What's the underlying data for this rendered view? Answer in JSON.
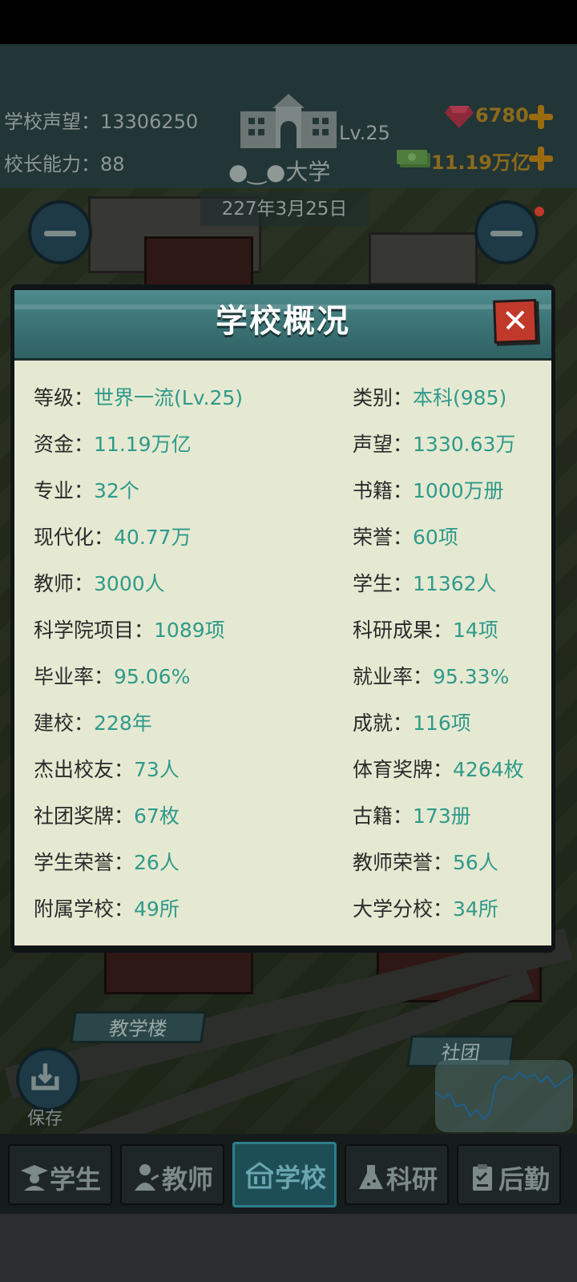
{
  "hud": {
    "reputation_label": "学校声望：",
    "reputation_value": "13306250",
    "ability_label": "校长能力：",
    "ability_value": "88",
    "level": "Lv.25",
    "school_name": "大学",
    "gems": "6780",
    "money": "11.19万亿",
    "date": "227年3月25日"
  },
  "panel": {
    "title": "学校概况",
    "rows": [
      {
        "left_key": "等级：",
        "left_val": "世界一流(Lv.25)",
        "right_key": "类别：",
        "right_val": "本科(985)"
      },
      {
        "left_key": "资金：",
        "left_val": "11.19万亿",
        "right_key": "声望：",
        "right_val": "1330.63万"
      },
      {
        "left_key": "专业：",
        "left_val": "32个",
        "right_key": "书籍：",
        "right_val": "1000万册"
      },
      {
        "left_key": "现代化：",
        "left_val": "40.77万",
        "right_key": "荣誉：",
        "right_val": "60项"
      },
      {
        "left_key": "教师：",
        "left_val": "3000人",
        "right_key": "学生：",
        "right_val": "11362人"
      },
      {
        "left_key": "科学院项目：",
        "left_val": "1089项",
        "right_key": "科研成果：",
        "right_val": "14项"
      },
      {
        "left_key": "毕业率：",
        "left_val": "95.06%",
        "right_key": "就业率：",
        "right_val": "95.33%"
      },
      {
        "left_key": "建校：",
        "left_val": "228年",
        "right_key": "成就：",
        "right_val": "116项"
      },
      {
        "left_key": "杰出校友：",
        "left_val": "73人",
        "right_key": "体育奖牌：",
        "right_val": "4264枚"
      },
      {
        "left_key": "社团奖牌：",
        "left_val": "67枚",
        "right_key": "古籍：",
        "right_val": "173册"
      },
      {
        "left_key": "学生荣誉：",
        "left_val": "26人",
        "right_key": "教师荣誉：",
        "right_val": "56人"
      },
      {
        "left_key": "附属学校：",
        "left_val": "49所",
        "right_key": "大学分校：",
        "right_val": "34所"
      }
    ]
  },
  "map": {
    "building_label": "教学楼",
    "club_label": "社团",
    "save_label": "保存"
  },
  "nav": {
    "students": "学生",
    "teachers": "教师",
    "school": "学校",
    "research": "科研",
    "logistics": "后勤"
  },
  "icons": [
    "building-emblem-icon",
    "gem-icon",
    "money-icon",
    "plus-icon",
    "close-icon",
    "save-icon",
    "graduate-icon",
    "teacher-icon",
    "school-icon",
    "flask-icon",
    "clipboard-icon"
  ]
}
